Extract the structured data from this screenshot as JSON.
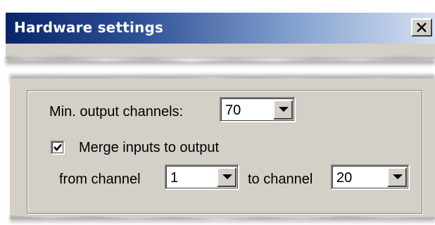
{
  "window": {
    "title": "Hardware settings",
    "close_icon": "close-icon"
  },
  "min_output": {
    "label": "Min. output channels:",
    "value": "70"
  },
  "merge": {
    "label": "Merge inputs to output",
    "checked": true
  },
  "from_channel": {
    "label": "from channel",
    "value": "1"
  },
  "to_channel": {
    "label": "to channel",
    "value": "20"
  },
  "colors": {
    "title_start": "#0a246a",
    "title_end": "#d6dff0",
    "dialog_bg": "#d4d0c8"
  }
}
